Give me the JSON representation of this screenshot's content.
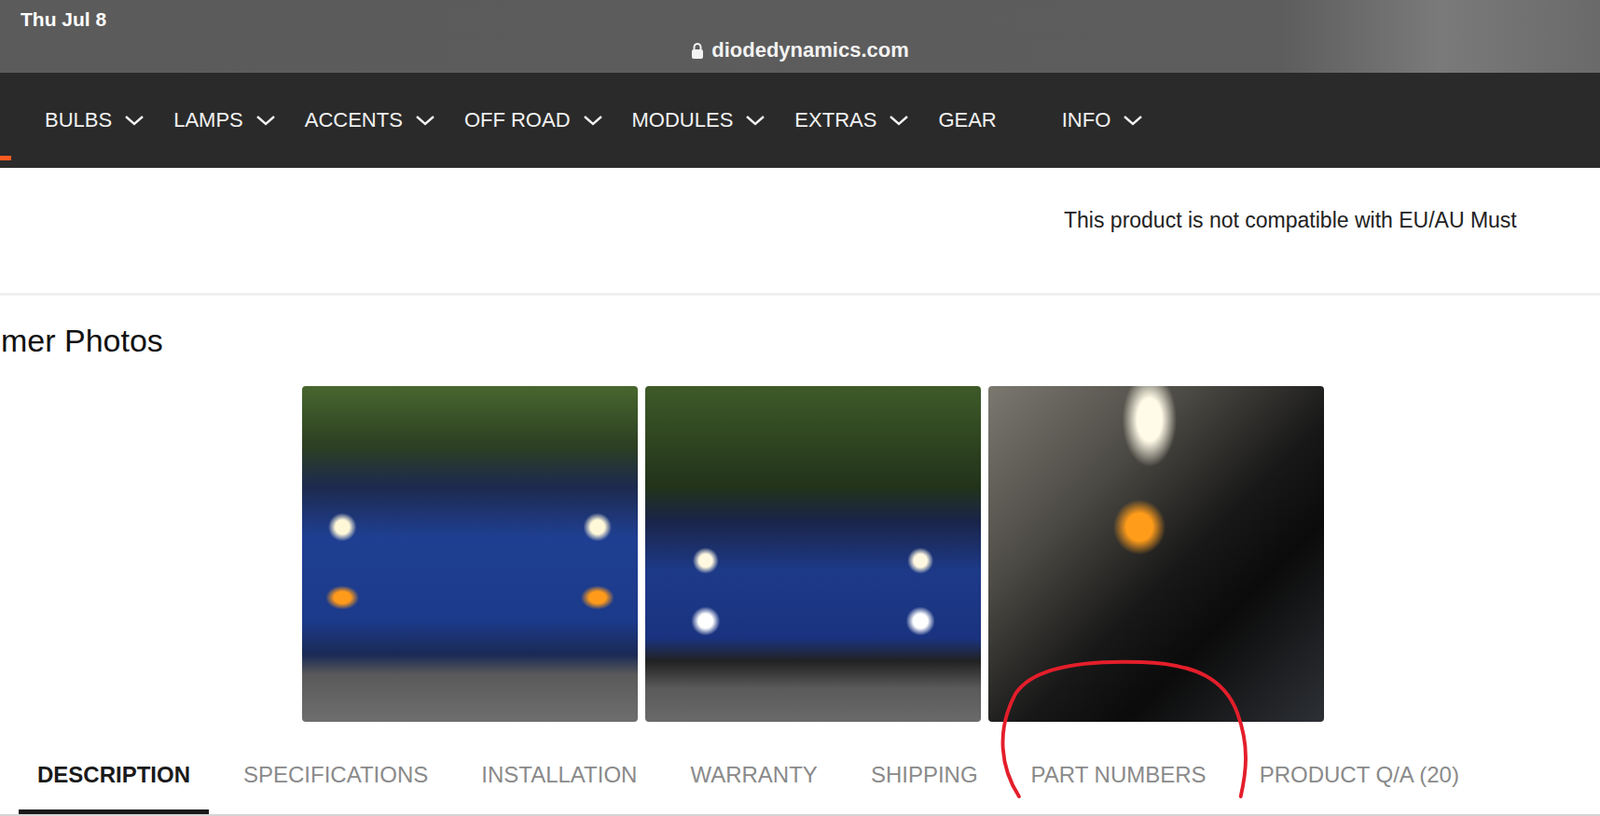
{
  "status_bar": {
    "time": "Thu Jul 8",
    "url": "diodedynamics.com"
  },
  "nav": {
    "items": [
      {
        "label": "BULBS",
        "dropdown": true
      },
      {
        "label": "LAMPS",
        "dropdown": true
      },
      {
        "label": "ACCENTS",
        "dropdown": true
      },
      {
        "label": "OFF ROAD",
        "dropdown": true
      },
      {
        "label": "MODULES",
        "dropdown": true
      },
      {
        "label": "EXTRAS",
        "dropdown": true
      },
      {
        "label": "GEAR",
        "dropdown": false
      },
      {
        "label": "INFO",
        "dropdown": true
      }
    ]
  },
  "notice": "This product is not compatible with EU/AU Must",
  "photos": {
    "heading": "mer Photos"
  },
  "tabs": [
    {
      "label": "DESCRIPTION",
      "selected": true,
      "circled": false
    },
    {
      "label": "SPECIFICATIONS",
      "selected": false,
      "circled": false
    },
    {
      "label": "INSTALLATION",
      "selected": false,
      "circled": false
    },
    {
      "label": "WARRANTY",
      "selected": false,
      "circled": false
    },
    {
      "label": "SHIPPING",
      "selected": false,
      "circled": false
    },
    {
      "label": "PART NUMBERS",
      "selected": false,
      "circled": true
    },
    {
      "label": "PRODUCT Q/A (20)",
      "selected": false,
      "circled": false
    }
  ]
}
